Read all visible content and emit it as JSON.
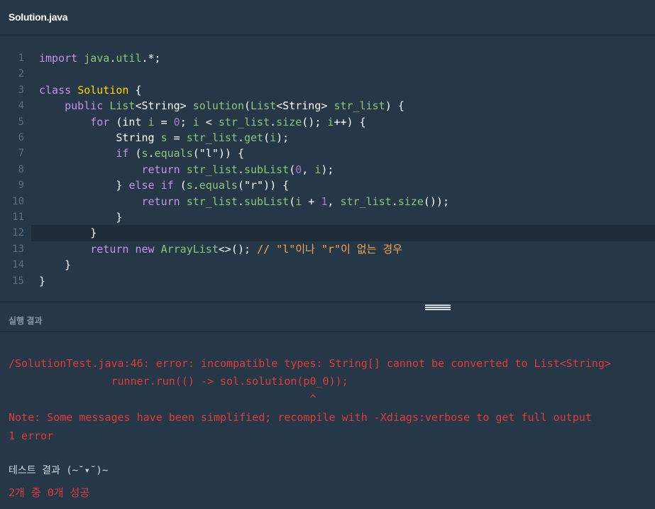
{
  "tab": {
    "filename": "Solution.java"
  },
  "editor": {
    "active_line": 12,
    "lines": [
      {
        "n": "1",
        "tokens": [
          [
            "kw",
            "import "
          ],
          [
            "ty",
            "java"
          ],
          [
            "pl",
            "."
          ],
          [
            "ty",
            "util"
          ],
          [
            "pl",
            ".*;"
          ]
        ]
      },
      {
        "n": "2",
        "tokens": []
      },
      {
        "n": "3",
        "tokens": [
          [
            "kw",
            "class "
          ],
          [
            "cls",
            "Solution"
          ],
          [
            "pl",
            " {"
          ]
        ]
      },
      {
        "n": "4",
        "tokens": [
          [
            "pl",
            "    "
          ],
          [
            "kw",
            "public "
          ],
          [
            "ty",
            "List"
          ],
          [
            "pl",
            "<String> "
          ],
          [
            "fn",
            "solution"
          ],
          [
            "pl",
            "("
          ],
          [
            "ty",
            "List"
          ],
          [
            "pl",
            "<String> "
          ],
          [
            "vr",
            "str_list"
          ],
          [
            "pl",
            ") {"
          ]
        ]
      },
      {
        "n": "5",
        "tokens": [
          [
            "pl",
            "        "
          ],
          [
            "kw",
            "for "
          ],
          [
            "pl",
            "(int "
          ],
          [
            "vr",
            "i"
          ],
          [
            "pl",
            " = "
          ],
          [
            "num",
            "0"
          ],
          [
            "pl",
            "; "
          ],
          [
            "vr",
            "i"
          ],
          [
            "pl",
            " < "
          ],
          [
            "vr",
            "str_list"
          ],
          [
            "pl",
            "."
          ],
          [
            "fn",
            "size"
          ],
          [
            "pl",
            "(); "
          ],
          [
            "vr",
            "i"
          ],
          [
            "pl",
            "++) {"
          ]
        ]
      },
      {
        "n": "6",
        "tokens": [
          [
            "pl",
            "            String "
          ],
          [
            "vr",
            "s"
          ],
          [
            "pl",
            " = "
          ],
          [
            "vr",
            "str_list"
          ],
          [
            "pl",
            "."
          ],
          [
            "fn",
            "get"
          ],
          [
            "pl",
            "("
          ],
          [
            "vr",
            "i"
          ],
          [
            "pl",
            ");"
          ]
        ]
      },
      {
        "n": "7",
        "tokens": [
          [
            "pl",
            "            "
          ],
          [
            "kw",
            "if "
          ],
          [
            "pl",
            "("
          ],
          [
            "vr",
            "s"
          ],
          [
            "pl",
            "."
          ],
          [
            "fn",
            "equals"
          ],
          [
            "pl",
            "("
          ],
          [
            "str",
            "\"l\""
          ],
          [
            "pl",
            ")) {"
          ]
        ]
      },
      {
        "n": "8",
        "tokens": [
          [
            "pl",
            "                "
          ],
          [
            "kw",
            "return "
          ],
          [
            "vr",
            "str_list"
          ],
          [
            "pl",
            "."
          ],
          [
            "fn",
            "subList"
          ],
          [
            "pl",
            "("
          ],
          [
            "num",
            "0"
          ],
          [
            "pl",
            ", "
          ],
          [
            "vr",
            "i"
          ],
          [
            "pl",
            ");"
          ]
        ]
      },
      {
        "n": "9",
        "tokens": [
          [
            "pl",
            "            } "
          ],
          [
            "kw",
            "else if "
          ],
          [
            "pl",
            "("
          ],
          [
            "vr",
            "s"
          ],
          [
            "pl",
            "."
          ],
          [
            "fn",
            "equals"
          ],
          [
            "pl",
            "("
          ],
          [
            "str",
            "\"r\""
          ],
          [
            "pl",
            ")) {"
          ]
        ]
      },
      {
        "n": "10",
        "tokens": [
          [
            "pl",
            "                "
          ],
          [
            "kw",
            "return "
          ],
          [
            "vr",
            "str_list"
          ],
          [
            "pl",
            "."
          ],
          [
            "fn",
            "subList"
          ],
          [
            "pl",
            "("
          ],
          [
            "vr",
            "i"
          ],
          [
            "pl",
            " + "
          ],
          [
            "num",
            "1"
          ],
          [
            "pl",
            ", "
          ],
          [
            "vr",
            "str_list"
          ],
          [
            "pl",
            "."
          ],
          [
            "fn",
            "size"
          ],
          [
            "pl",
            "());"
          ]
        ]
      },
      {
        "n": "11",
        "tokens": [
          [
            "pl",
            "            }"
          ]
        ]
      },
      {
        "n": "12",
        "tokens": [
          [
            "pl",
            "        }"
          ]
        ]
      },
      {
        "n": "13",
        "tokens": [
          [
            "pl",
            "        "
          ],
          [
            "kw",
            "return new "
          ],
          [
            "ty",
            "ArrayList"
          ],
          [
            "pl",
            "<>(); "
          ],
          [
            "cm",
            "// \"l\"이나 \"r\"이 없는 경우"
          ]
        ]
      },
      {
        "n": "14",
        "tokens": [
          [
            "pl",
            "    }"
          ]
        ]
      },
      {
        "n": "15",
        "tokens": [
          [
            "pl",
            "}"
          ]
        ]
      }
    ]
  },
  "result": {
    "header": "실행 결과",
    "error_line1": "/SolutionTest.java:46: error: incompatible types: String[] cannot be converted to List<String>",
    "error_line2": "                runner.run(() -> sol.solution(p0_0));",
    "error_caret": "                                               ^",
    "note": "Note: Some messages have been simplified; recompile with -Xdiags:verbose to get full output",
    "error_count": "1 error",
    "test_result_label": "테스트 결과 (~˘▾˘)~",
    "test_summary": "2개 중 0개 성공"
  },
  "colors": {
    "background": "#263747",
    "error": "#e03c3c",
    "keyword": "#c792ea",
    "class_name": "#ffd700",
    "identifier": "#8bc57a",
    "comment": "#f3a552"
  }
}
